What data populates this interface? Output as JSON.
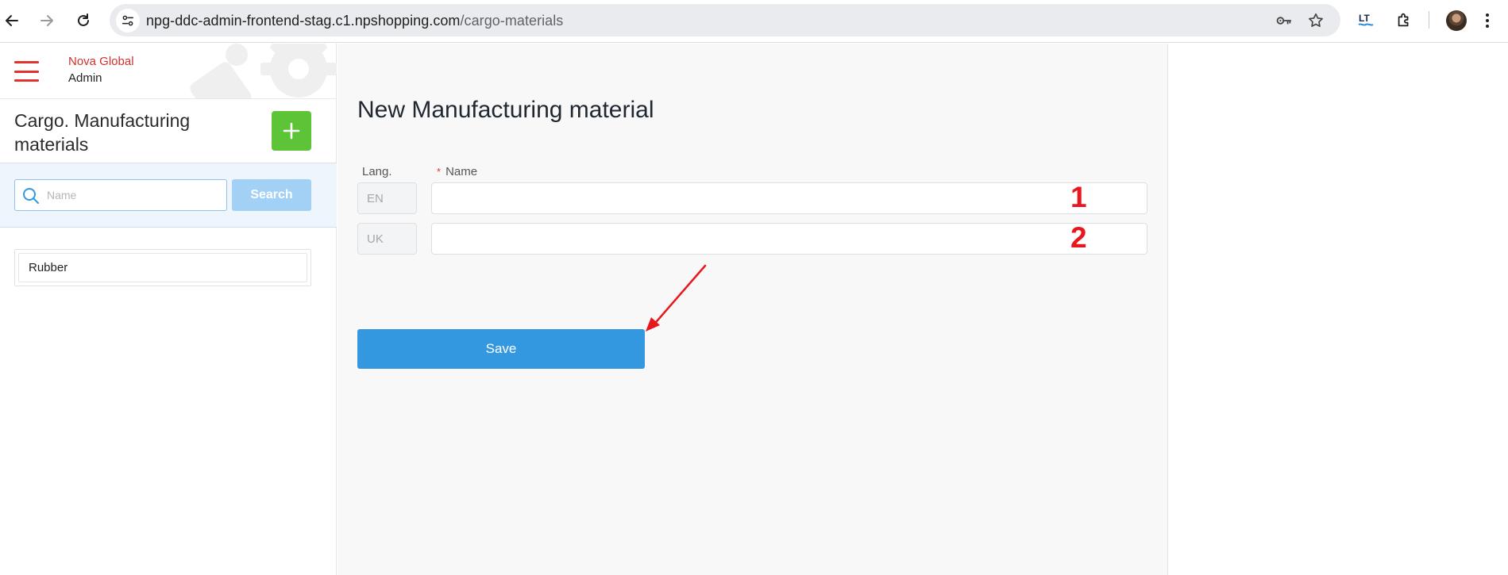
{
  "browser": {
    "url_host": "npg-ddc-admin-frontend-stag.c1.npshopping.com",
    "url_path": "/cargo-materials",
    "extension_label": "LT"
  },
  "sidebar": {
    "brand_name": "Nova Global",
    "brand_sub": "Admin",
    "section_title": "Cargo. Manufacturing materials",
    "add_button_label": "+",
    "search": {
      "placeholder": "Name",
      "value": "",
      "button_label": "Search"
    },
    "items": [
      {
        "label": "Rubber"
      }
    ]
  },
  "form": {
    "title": "New Manufacturing material",
    "lang_label": "Lang.",
    "name_label": "Name",
    "required_mark": "*",
    "rows": [
      {
        "lang": "EN",
        "value": "",
        "annotation": "1"
      },
      {
        "lang": "UK",
        "value": "",
        "annotation": "2"
      }
    ],
    "save_label": "Save"
  },
  "colors": {
    "brand_red": "#d0312d",
    "add_green": "#5ec437",
    "save_blue": "#3498e0",
    "search_button_blue": "#a3d0f5",
    "annotation_red": "#e8171d"
  }
}
